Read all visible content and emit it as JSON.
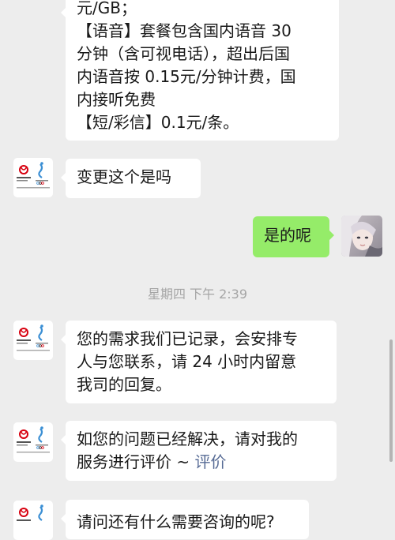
{
  "messages": {
    "m1": {
      "lines": [
        "元/GB；",
        "【语音】套餐包含国内语音 30",
        "分钟（含可视电话），超出后国",
        "内语音按 0.15元/分钟计费，国",
        "内接听免费",
        "【短/彩信】0.1元/条。"
      ]
    },
    "m2": {
      "text": "变更这个是吗"
    },
    "m3": {
      "text": "是的呢"
    },
    "timestamp": "星期四 下午 2:39",
    "m4": {
      "lines": [
        "您的需求我们已记录，会安排专",
        "人与您联系，请 24 小时内留意",
        "我司的回复。"
      ]
    },
    "m5": {
      "line1": "如您的问题已经解决，请对我的",
      "line2_prefix": "服务进行评价 ~ ",
      "line2_link": "评价"
    },
    "m6": {
      "text": "请问还有什么需要咨询的呢?"
    }
  },
  "colors": {
    "background": "#ededed",
    "bubble_received": "#ffffff",
    "bubble_sent": "#95ec69",
    "link": "#576b95",
    "timestamp": "#a5a5a5"
  },
  "icons": {
    "agent_avatar": "china-unicom-logo",
    "user_avatar": "user-photo"
  }
}
